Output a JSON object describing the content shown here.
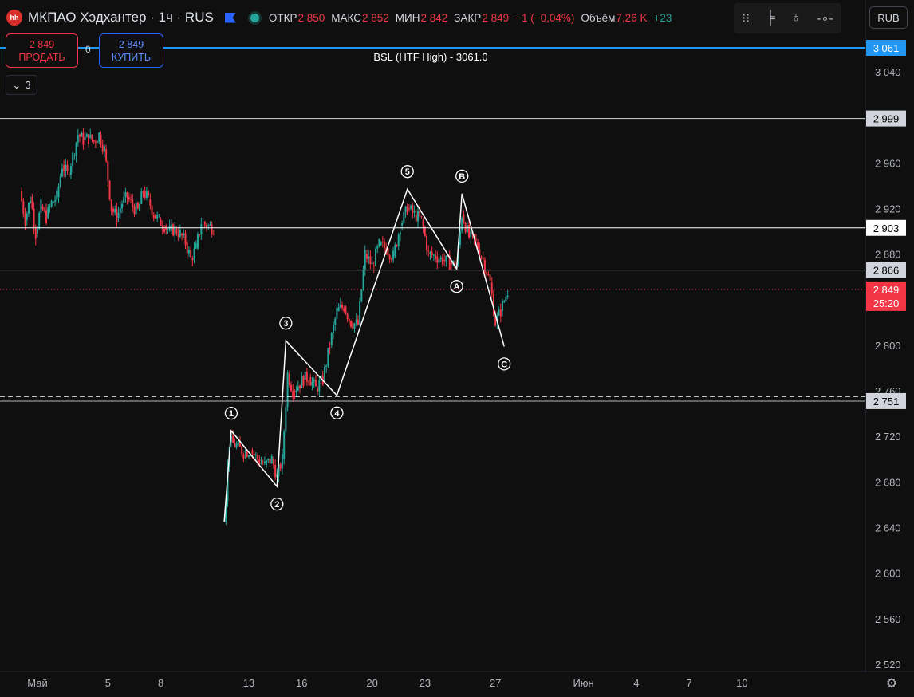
{
  "header": {
    "symbol": "МКПАО Хэдхантер · 1ч · RUS",
    "logo_text": "hh",
    "open_label": "ОТКР",
    "open_value": "2 850",
    "high_label": "МАКС",
    "high_value": "2 852",
    "low_label": "МИН",
    "low_value": "2 842",
    "close_label": "ЗАКР",
    "close_value": "2 849",
    "change_value": "−1 (−0,04%)",
    "volume_label": "Объём",
    "volume_value": "7,26 K",
    "volume_delta": "+23",
    "currency": "RUB"
  },
  "trade": {
    "sell_price": "2 849",
    "sell_label": "ПРОДАТЬ",
    "spread": "0",
    "buy_price": "2 849",
    "buy_label": "КУПИТЬ"
  },
  "indicators_count": "3",
  "colors": {
    "up": "#26a69a",
    "down": "#f23645",
    "bg": "#0f0f0f",
    "accent": "#2962ff"
  },
  "chart_data": {
    "type": "candlestick",
    "ylim": [
      2508,
      3075
    ],
    "y_ticks": [
      2520,
      2560,
      2600,
      2640,
      2680,
      2720,
      2760,
      2800,
      2840,
      2880,
      2920,
      2960,
      3000,
      3040
    ],
    "y_tick_labels": [
      "2 520",
      "2 560",
      "2 600",
      "2 640",
      "2 680",
      "2 720",
      "2 760",
      "2 800",
      "2 840",
      "2 880",
      "2 920",
      "2 960",
      "3 000",
      "3 040"
    ],
    "x_ticks": [
      {
        "label": "Май",
        "day": 1
      },
      {
        "label": "5",
        "day": 5
      },
      {
        "label": "8",
        "day": 8
      },
      {
        "label": "13",
        "day": 13
      },
      {
        "label": "16",
        "day": 16
      },
      {
        "label": "20",
        "day": 20
      },
      {
        "label": "23",
        "day": 23
      },
      {
        "label": "27",
        "day": 27
      },
      {
        "label": "Июн",
        "day": 32
      },
      {
        "label": "4",
        "day": 35
      },
      {
        "label": "7",
        "day": 38
      },
      {
        "label": "10",
        "day": 41
      }
    ],
    "horizontal_lines": [
      {
        "price": 3061,
        "label": "3 061",
        "style": "solid",
        "color": "#2196f3",
        "text": "BSL (HTF High) - 3061.0"
      },
      {
        "price": 2999,
        "label": "2 999",
        "style": "solid",
        "color": "#d1d4dc",
        "text": ""
      },
      {
        "price": 2903,
        "label": "2 903",
        "style": "solid",
        "color": "#ffffff",
        "text": ""
      },
      {
        "price": 2866,
        "label": "2 866",
        "style": "solid",
        "color": "#b2b5be",
        "text": ""
      },
      {
        "price": 2755,
        "label": "",
        "style": "dashed",
        "color": "#ffffff",
        "text": ""
      },
      {
        "price": 2751,
        "label": "2 751",
        "style": "solid",
        "color": "#b2b5be",
        "text": ""
      }
    ],
    "current_price": {
      "price": 2849,
      "label": "2 849",
      "countdown": "25:20"
    },
    "wave_count": [
      {
        "day": 11.6,
        "price": 2645,
        "label": ""
      },
      {
        "day": 12.0,
        "price": 2725,
        "label": "1"
      },
      {
        "day": 14.6,
        "price": 2676,
        "label": "2"
      },
      {
        "day": 15.1,
        "price": 2804,
        "label": "3"
      },
      {
        "day": 18.0,
        "price": 2756,
        "label": "4"
      },
      {
        "day": 22.0,
        "price": 2937,
        "label": "5"
      },
      {
        "day": 24.8,
        "price": 2867,
        "label": "A"
      },
      {
        "day": 25.1,
        "price": 2933,
        "label": "B"
      },
      {
        "day": 27.5,
        "price": 2799,
        "label": "C"
      }
    ],
    "segment1": [
      [
        0.0,
        2935
      ],
      [
        0.3,
        2910
      ],
      [
        0.6,
        2930
      ],
      [
        0.9,
        2898
      ],
      [
        1.2,
        2922
      ],
      [
        1.5,
        2912
      ],
      [
        1.8,
        2925
      ],
      [
        2.1,
        2930
      ],
      [
        2.4,
        2958
      ],
      [
        2.7,
        2950
      ],
      [
        3.0,
        2966
      ],
      [
        3.3,
        2985
      ],
      [
        3.6,
        2980
      ],
      [
        3.9,
        2982
      ],
      [
        4.2,
        2979
      ],
      [
        4.5,
        2985
      ],
      [
        4.8,
        2972
      ],
      [
        5.2,
        2920
      ],
      [
        5.5,
        2912
      ],
      [
        5.8,
        2925
      ],
      [
        6.1,
        2930
      ],
      [
        6.4,
        2922
      ],
      [
        6.7,
        2918
      ],
      [
        7.0,
        2935
      ],
      [
        7.3,
        2928
      ],
      [
        7.6,
        2915
      ],
      [
        7.9,
        2910
      ],
      [
        8.2,
        2905
      ],
      [
        8.5,
        2900
      ],
      [
        8.8,
        2902
      ],
      [
        9.1,
        2898
      ],
      [
        9.4,
        2890
      ],
      [
        9.7,
        2876
      ],
      [
        10.0,
        2885
      ],
      [
        10.3,
        2908
      ],
      [
        10.6,
        2905
      ],
      [
        11.0,
        2903
      ]
    ],
    "segment2": [
      [
        11.6,
        2645
      ],
      [
        11.9,
        2715
      ],
      [
        12.3,
        2712
      ],
      [
        12.7,
        2706
      ],
      [
        13.1,
        2708
      ],
      [
        13.5,
        2700
      ],
      [
        13.9,
        2695
      ],
      [
        14.3,
        2700
      ],
      [
        14.6,
        2685
      ],
      [
        14.9,
        2700
      ],
      [
        15.2,
        2775
      ],
      [
        15.5,
        2760
      ],
      [
        15.8,
        2765
      ],
      [
        16.1,
        2770
      ],
      [
        16.4,
        2772
      ],
      [
        16.8,
        2762
      ],
      [
        17.2,
        2770
      ],
      [
        17.6,
        2800
      ],
      [
        18.0,
        2830
      ],
      [
        18.4,
        2834
      ],
      [
        18.8,
        2820
      ],
      [
        19.2,
        2818
      ],
      [
        19.6,
        2880
      ],
      [
        20.0,
        2870
      ],
      [
        20.4,
        2888
      ],
      [
        20.8,
        2885
      ],
      [
        21.2,
        2878
      ],
      [
        21.6,
        2905
      ],
      [
        22.0,
        2920
      ],
      [
        22.4,
        2915
      ],
      [
        22.8,
        2910
      ],
      [
        23.2,
        2880
      ],
      [
        23.6,
        2878
      ],
      [
        24.0,
        2875
      ],
      [
        24.4,
        2872
      ],
      [
        24.8,
        2870
      ],
      [
        25.1,
        2915
      ],
      [
        25.5,
        2895
      ],
      [
        25.9,
        2890
      ],
      [
        26.3,
        2875
      ],
      [
        26.7,
        2855
      ],
      [
        27.0,
        2820
      ],
      [
        27.3,
        2830
      ],
      [
        27.7,
        2848
      ]
    ]
  }
}
